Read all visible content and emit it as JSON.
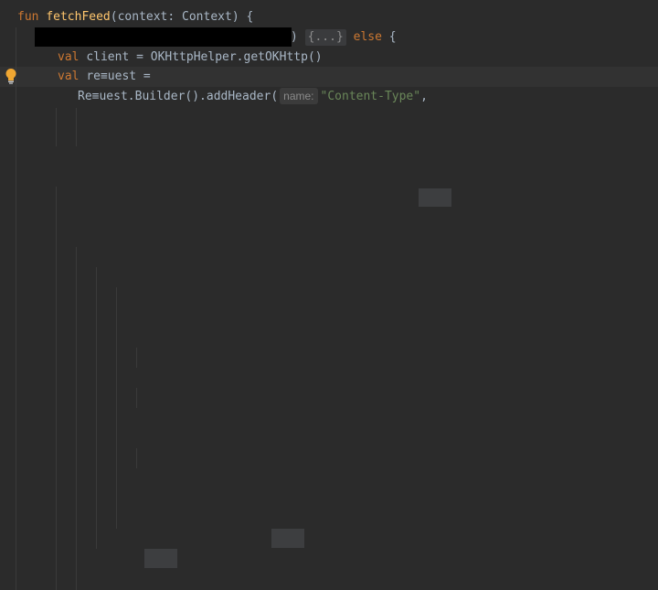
{
  "editor": {
    "line1": {
      "kw": "fun",
      "name": "fetchFeed",
      "rest": "(context: Context) {"
    },
    "line2": {
      "paren": ")",
      "fold": "{...}",
      "kw": "else",
      "rest": "{"
    },
    "line3": {
      "kw": "val",
      "rest": "client = OKHttpHelper.getOKHttp()"
    },
    "line4": {
      "kw": "val",
      "rest": "re≡uest ="
    },
    "line5": {
      "code": "Re≡uest.Builder().addHeader(",
      "hint": "name:",
      "str": "\"Content-Type\"",
      "comma": ","
    }
  },
  "icons": {
    "intention": "lightbulb-icon"
  },
  "colors": {
    "background": "#2b2b2b",
    "keyword": "#cc7832",
    "function": "#ffc66d",
    "string": "#6a8759",
    "text": "#a9b7c6",
    "bulb": "#f0a732"
  }
}
